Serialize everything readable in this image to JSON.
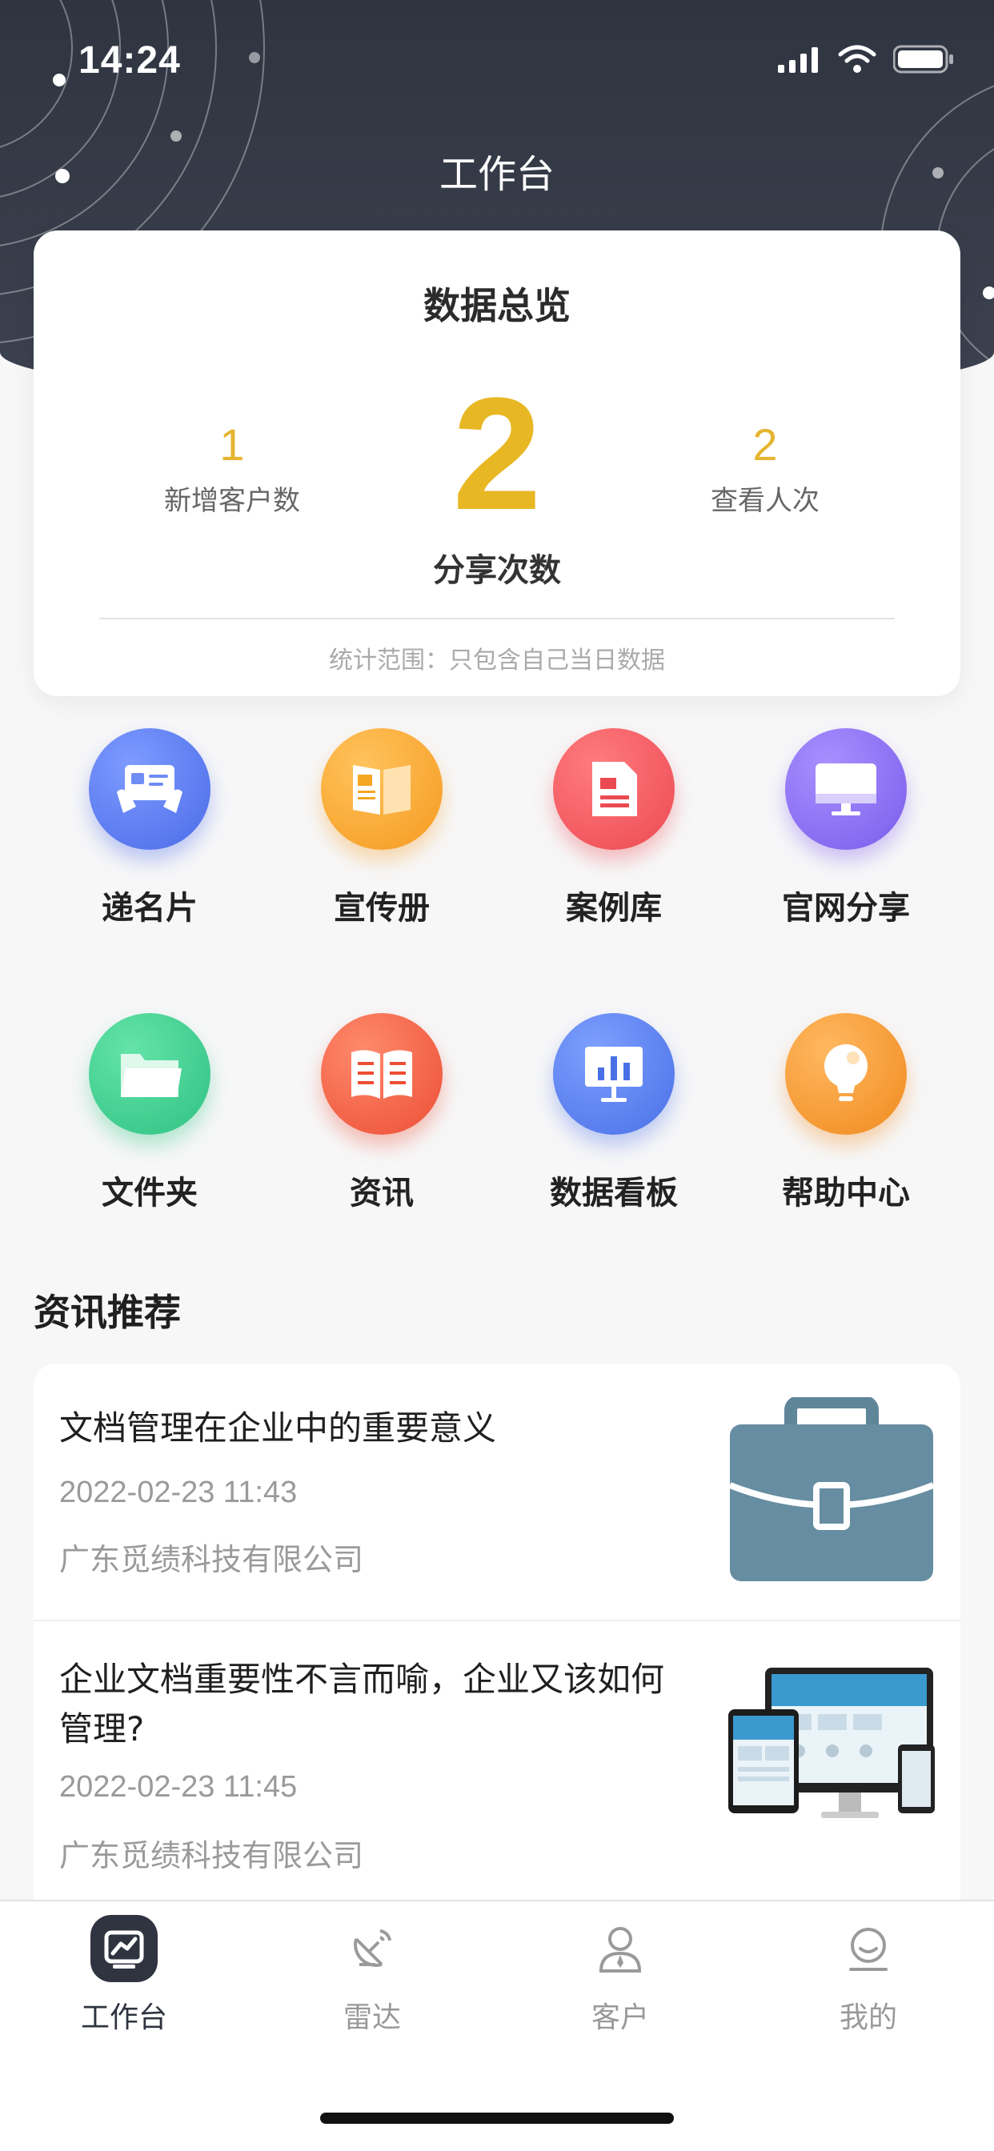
{
  "status_bar": {
    "time": "14:24"
  },
  "page_title": "工作台",
  "overview": {
    "title": "数据总览",
    "new_customers": {
      "value": "1",
      "label": "新增客户数"
    },
    "shares": {
      "value": "2",
      "label": "分享次数"
    },
    "views": {
      "value": "2",
      "label": "查看人次"
    },
    "note": "统计范围：只包含自己当日数据"
  },
  "features": [
    {
      "label": "递名片",
      "icon": "business-card-icon",
      "color": "#5b7cf2"
    },
    {
      "label": "宣传册",
      "icon": "brochure-icon",
      "color": "#f5a623"
    },
    {
      "label": "案例库",
      "icon": "case-library-icon",
      "color": "#f0565a"
    },
    {
      "label": "官网分享",
      "icon": "website-share-icon",
      "color": "#8a6cf2"
    },
    {
      "label": "文件夹",
      "icon": "folder-icon",
      "color": "#3ccf8e"
    },
    {
      "label": "资讯",
      "icon": "news-icon",
      "color": "#f26043"
    },
    {
      "label": "数据看板",
      "icon": "dashboard-icon",
      "color": "#5a82f2"
    },
    {
      "label": "帮助中心",
      "icon": "help-bulb-icon",
      "color": "#f39a2e"
    }
  ],
  "news_section": {
    "title": "资讯推荐",
    "items": [
      {
        "title": "文档管理在企业中的重要意义",
        "date": "2022-02-23 11:43",
        "source": "广东觅绩科技有限公司",
        "thumb": "briefcase-icon"
      },
      {
        "title": "企业文档重要性不言而喻，企业又该如何管理?",
        "date": "2022-02-23 11:45",
        "source": "广东觅绩科技有限公司",
        "thumb": "devices-image"
      }
    ]
  },
  "tabbar": [
    {
      "label": "工作台",
      "icon": "workbench-icon",
      "active": true
    },
    {
      "label": "雷达",
      "icon": "radar-icon",
      "active": false
    },
    {
      "label": "客户",
      "icon": "customer-icon",
      "active": false
    },
    {
      "label": "我的",
      "icon": "profile-icon",
      "active": false
    }
  ],
  "colors": {
    "header": "#2f3440",
    "accent": "#e8b724",
    "background": "#f7f7f8"
  }
}
